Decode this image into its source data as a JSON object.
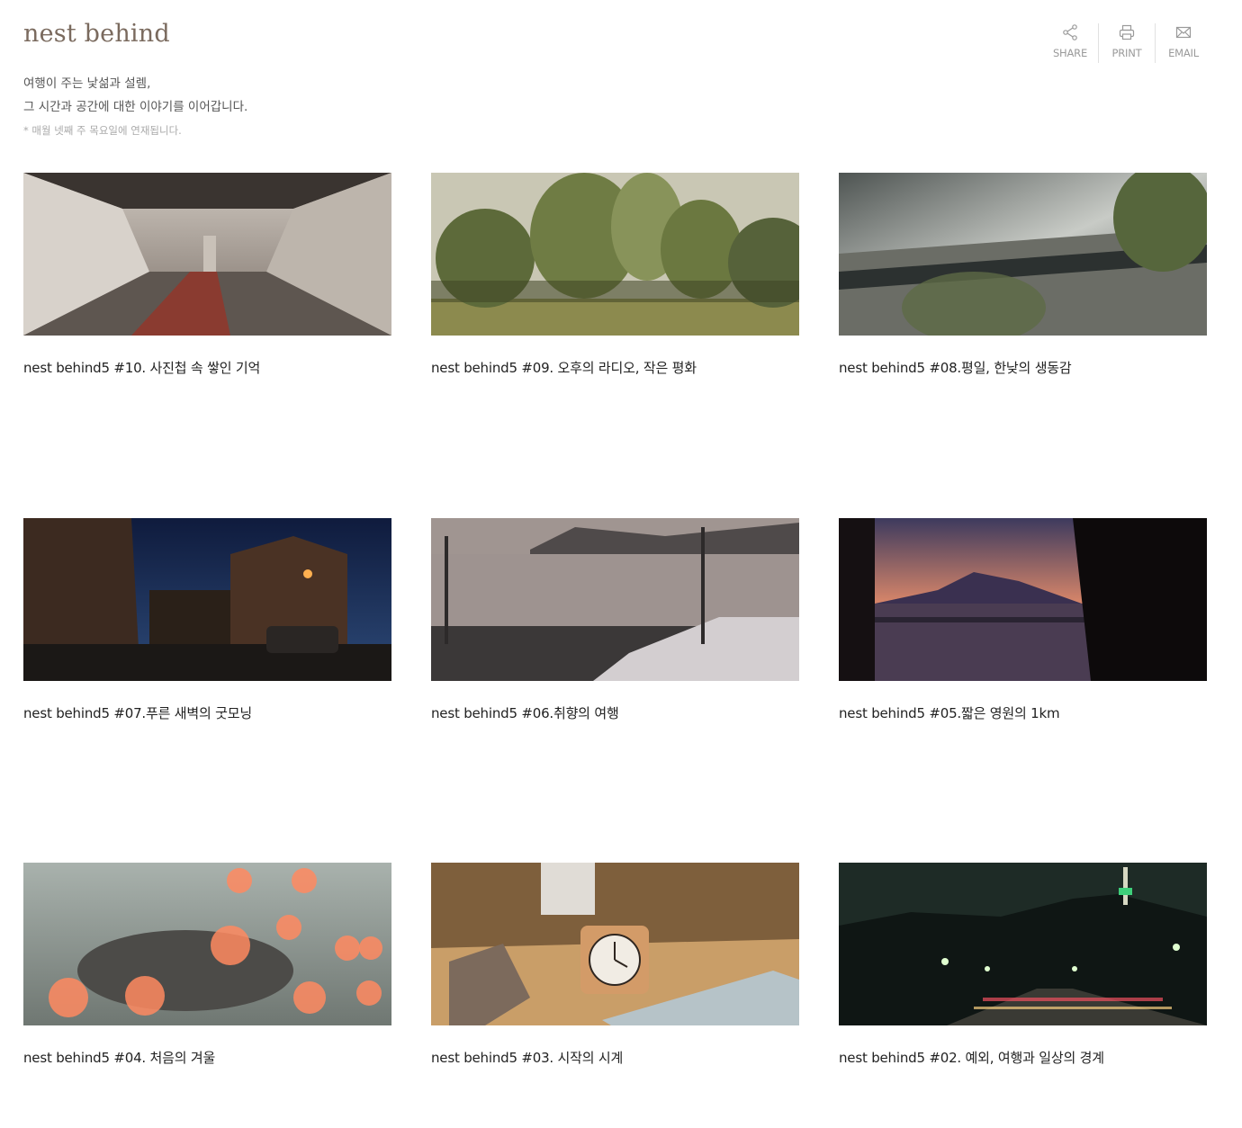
{
  "header": {
    "brand": "nest behind",
    "intro_line1": "여행이 주는 낯섦과 설렘,",
    "intro_line2": "그 시간과 공간에 대한 이야기를 이어갑니다.",
    "note": "* 매월 넷째 주 목요일에 연재됩니다."
  },
  "toolbar": {
    "share": {
      "label": "SHARE",
      "icon": "share-icon"
    },
    "print": {
      "label": "PRINT",
      "icon": "printer-icon"
    },
    "email": {
      "label": "EMAIL",
      "icon": "envelope-icon"
    }
  },
  "posts": [
    {
      "title": "nest behind5 #10. 사진첩 속 쌓인 기억"
    },
    {
      "title": "nest behind5 #09. 오후의 라디오, 작은 평화"
    },
    {
      "title": "nest behind5 #08.평일, 한낮의 생동감"
    },
    {
      "title": "nest behind5 #07.푸른 새벽의 굿모닝"
    },
    {
      "title": "nest behind5 #06.취향의 여행"
    },
    {
      "title": "nest behind5 #05.짧은 영원의 1km"
    },
    {
      "title": "nest behind5 #04. 처음의 겨울"
    },
    {
      "title": "nest behind5 #03. 시작의 시계"
    },
    {
      "title": "nest behind5 #02. 예외, 여행과 일상의 경계"
    }
  ]
}
